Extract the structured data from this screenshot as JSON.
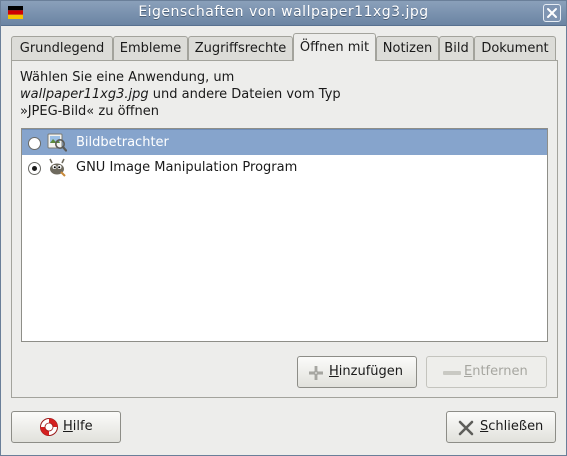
{
  "window": {
    "title": "Eigenschaften von wallpaper11xg3.jpg"
  },
  "tabs": [
    {
      "label": "Grundlegend"
    },
    {
      "label": "Embleme"
    },
    {
      "label": "Zugriffsrechte"
    },
    {
      "label": "Öffnen mit",
      "active": true
    },
    {
      "label": "Notizen"
    },
    {
      "label": "Bild"
    },
    {
      "label": "Dokument"
    }
  ],
  "description": {
    "line1": "Wählen Sie eine Anwendung, um",
    "filename": "wallpaper11xg3.jpg",
    "line2_rest": " und andere Dateien vom Typ",
    "line3": "»JPEG-Bild« zu öffnen"
  },
  "applications": [
    {
      "name": "Bildbetrachter",
      "selected_row": true,
      "default": false,
      "icon": "image-viewer-icon"
    },
    {
      "name": "GNU Image Manipulation Program",
      "selected_row": false,
      "default": true,
      "icon": "gimp-icon"
    }
  ],
  "buttons": {
    "add": {
      "pre": "",
      "accel": "H",
      "post": "inzufügen",
      "enabled": true,
      "icon": "plus-icon"
    },
    "remove": {
      "pre": "",
      "accel": "E",
      "post": "ntfernen",
      "enabled": false,
      "icon": "minus-icon"
    },
    "help": {
      "pre": "",
      "accel": "H",
      "post": "ilfe",
      "icon": "lifebuoy-icon"
    },
    "close": {
      "pre": "",
      "accel": "S",
      "post": "chließen",
      "icon": "close-x-icon"
    }
  },
  "colors": {
    "titlebar": "#7a91ae",
    "selection": "#86a4cc",
    "window_bg": "#ededeb"
  }
}
